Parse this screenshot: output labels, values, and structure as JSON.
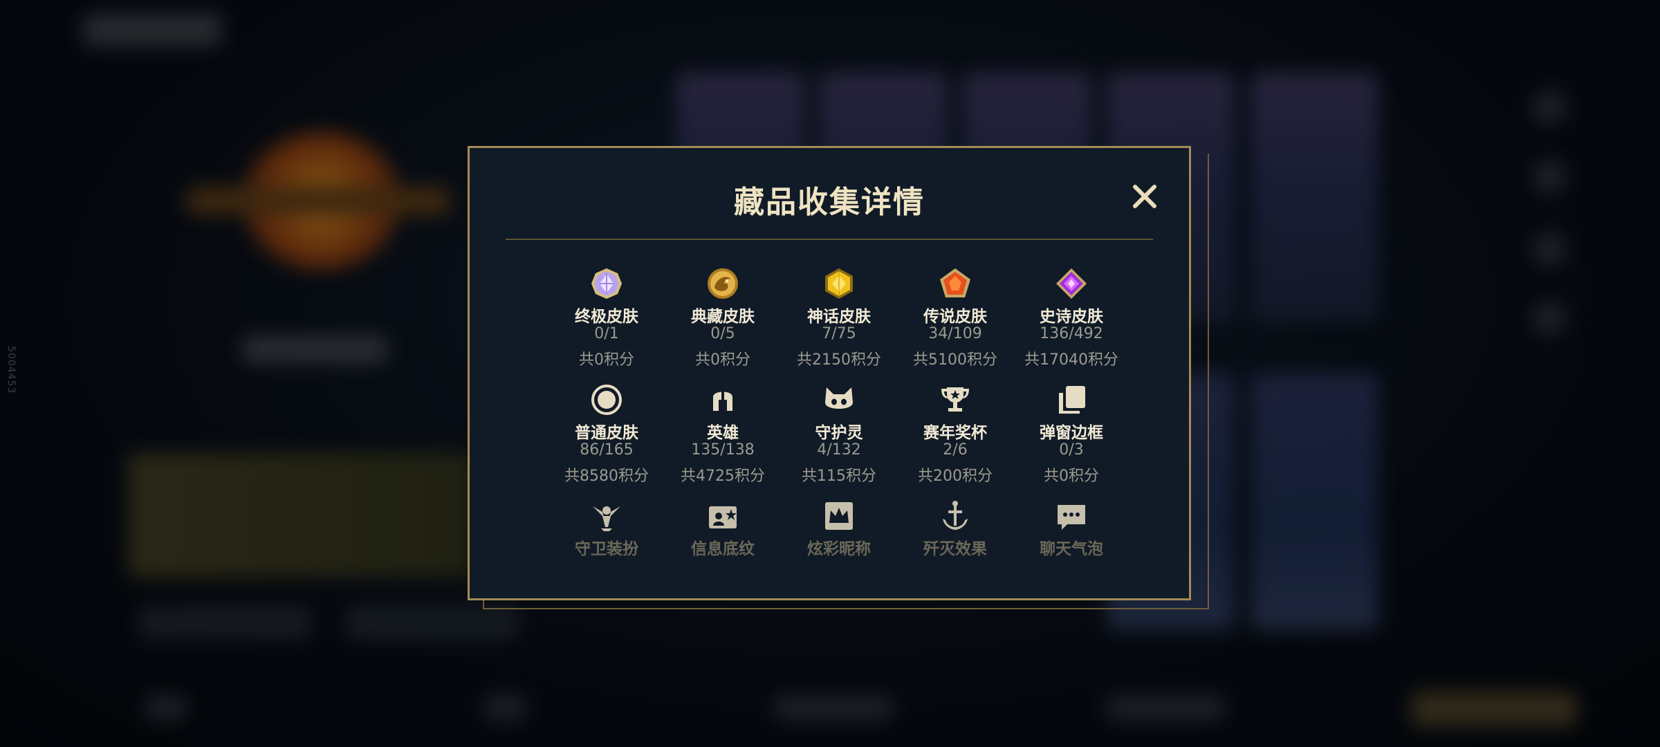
{
  "background": {
    "side_id": "5004453"
  },
  "modal": {
    "title": "藏品收集详情",
    "close_label": "✕"
  },
  "collections": [
    {
      "name": "终极皮肤",
      "count": "0/1",
      "points": "共0积分",
      "icon": "ultimate-skin-gem-icon"
    },
    {
      "name": "典藏皮肤",
      "count": "0/5",
      "points": "共0积分",
      "icon": "legacy-skin-dragon-icon"
    },
    {
      "name": "神话皮肤",
      "count": "7/75",
      "points": "共2150积分",
      "icon": "mythic-skin-gem-icon"
    },
    {
      "name": "传说皮肤",
      "count": "34/109",
      "points": "共5100积分",
      "icon": "legendary-skin-gem-icon"
    },
    {
      "name": "史诗皮肤",
      "count": "136/492",
      "points": "共17040积分",
      "icon": "epic-skin-gem-icon"
    },
    {
      "name": "普通皮肤",
      "count": "86/165",
      "points": "共8580积分",
      "icon": "normal-skin-circle-icon"
    },
    {
      "name": "英雄",
      "count": "135/138",
      "points": "共4725积分",
      "icon": "champion-helmet-icon"
    },
    {
      "name": "守护灵",
      "count": "4/132",
      "points": "共115积分",
      "icon": "guardian-pet-icon"
    },
    {
      "name": "赛年奖杯",
      "count": "2/6",
      "points": "共200积分",
      "icon": "season-trophy-icon"
    },
    {
      "name": "弹窗边框",
      "count": "0/3",
      "points": "共0积分",
      "icon": "popup-frame-icon"
    },
    {
      "name": "守卫装扮",
      "icon": "ward-skin-icon"
    },
    {
      "name": "信息底纹",
      "icon": "info-card-icon"
    },
    {
      "name": "炫彩昵称",
      "icon": "colorful-nickname-crown-icon"
    },
    {
      "name": "歼灭效果",
      "icon": "ace-effect-anchor-icon"
    },
    {
      "name": "聊天气泡",
      "icon": "chat-bubble-icon"
    }
  ],
  "colors": {
    "modal_bg": "#101b27",
    "modal_border": "#a48b56",
    "title": "#efe3c2",
    "accent_gold": "#c9a868"
  }
}
